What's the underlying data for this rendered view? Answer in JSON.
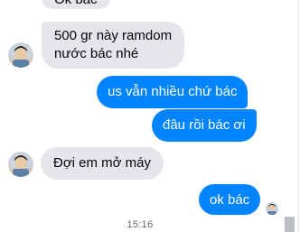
{
  "messages": [
    {
      "sender": "contact",
      "text": "Ok bác"
    },
    {
      "sender": "contact",
      "text": "500 gr này ramdom nước bác nhé",
      "lines": [
        "500 gr này ramdom",
        "nước bác nhé"
      ]
    },
    {
      "sender": "me",
      "text": "us vẫn nhiều chứ bác"
    },
    {
      "sender": "me",
      "text": "đâu rồi bác ơi"
    },
    {
      "sender": "contact",
      "text": "Đợi em mở máy"
    },
    {
      "sender": "me",
      "text": "ok bác"
    }
  ],
  "timestamp": "15:16",
  "colors": {
    "incoming_bubble": "#e4e6eb",
    "outgoing_bubble": "#0084ff",
    "timestamp_text": "#65676b"
  },
  "icons": {
    "avatar": "contact-avatar-photo",
    "seen_indicator": "seen-avatar-icon"
  }
}
